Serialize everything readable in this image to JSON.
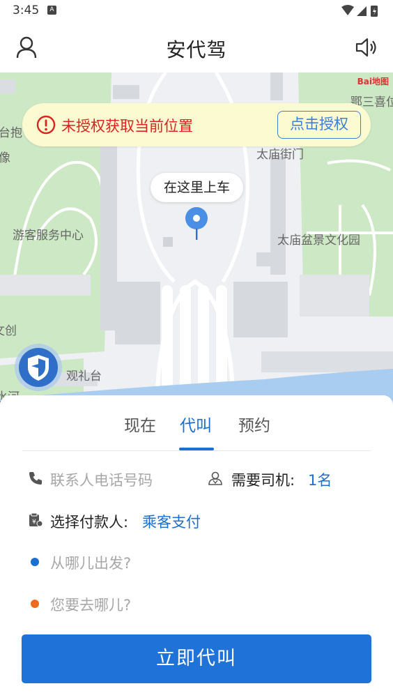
{
  "status_bar": {
    "time": "3:45",
    "notification_badge": "A"
  },
  "header": {
    "title": "安代驾",
    "user_icon": "user-icon",
    "sound_icon": "speaker-icon"
  },
  "map": {
    "provider_logo": "Bai地图",
    "labels": {
      "top_right": "鄂三喜位",
      "tai_miao_gate": "太庙街门",
      "visitor_center": "游客服务中心",
      "bonsai_park": "太庙盆景文化园",
      "viewing_platform": "观礼台",
      "left_1": "台抱",
      "left_2": "像",
      "left_3": "文创",
      "river": "水河"
    },
    "auth_banner": {
      "text": "未授权获取当前位置",
      "button": "点击授权",
      "icon": "alert-circle-icon"
    },
    "pickup_bubble": "在这里上车",
    "pin_icon": "location-pin-icon",
    "shield_icon": "safety-shield-icon"
  },
  "panel": {
    "tabs": [
      {
        "label": "现在",
        "active": false
      },
      {
        "label": "代叫",
        "active": true
      },
      {
        "label": "预约",
        "active": false
      }
    ],
    "contact_phone_placeholder": "联系人电话号码",
    "drivers_label": "需要司机:",
    "drivers_value": "1名",
    "payer_label": "选择付款人:",
    "payer_value": "乘客支付",
    "from_placeholder": "从哪儿出发?",
    "to_placeholder": "您要去哪儿?",
    "submit_label": "立即代叫"
  },
  "colors": {
    "accent": "#1e72d8",
    "alert": "#d9241f",
    "banner_bg": "#fcfad0",
    "origin_dot": "#1a6fd1",
    "destination_dot": "#f06a1e"
  }
}
